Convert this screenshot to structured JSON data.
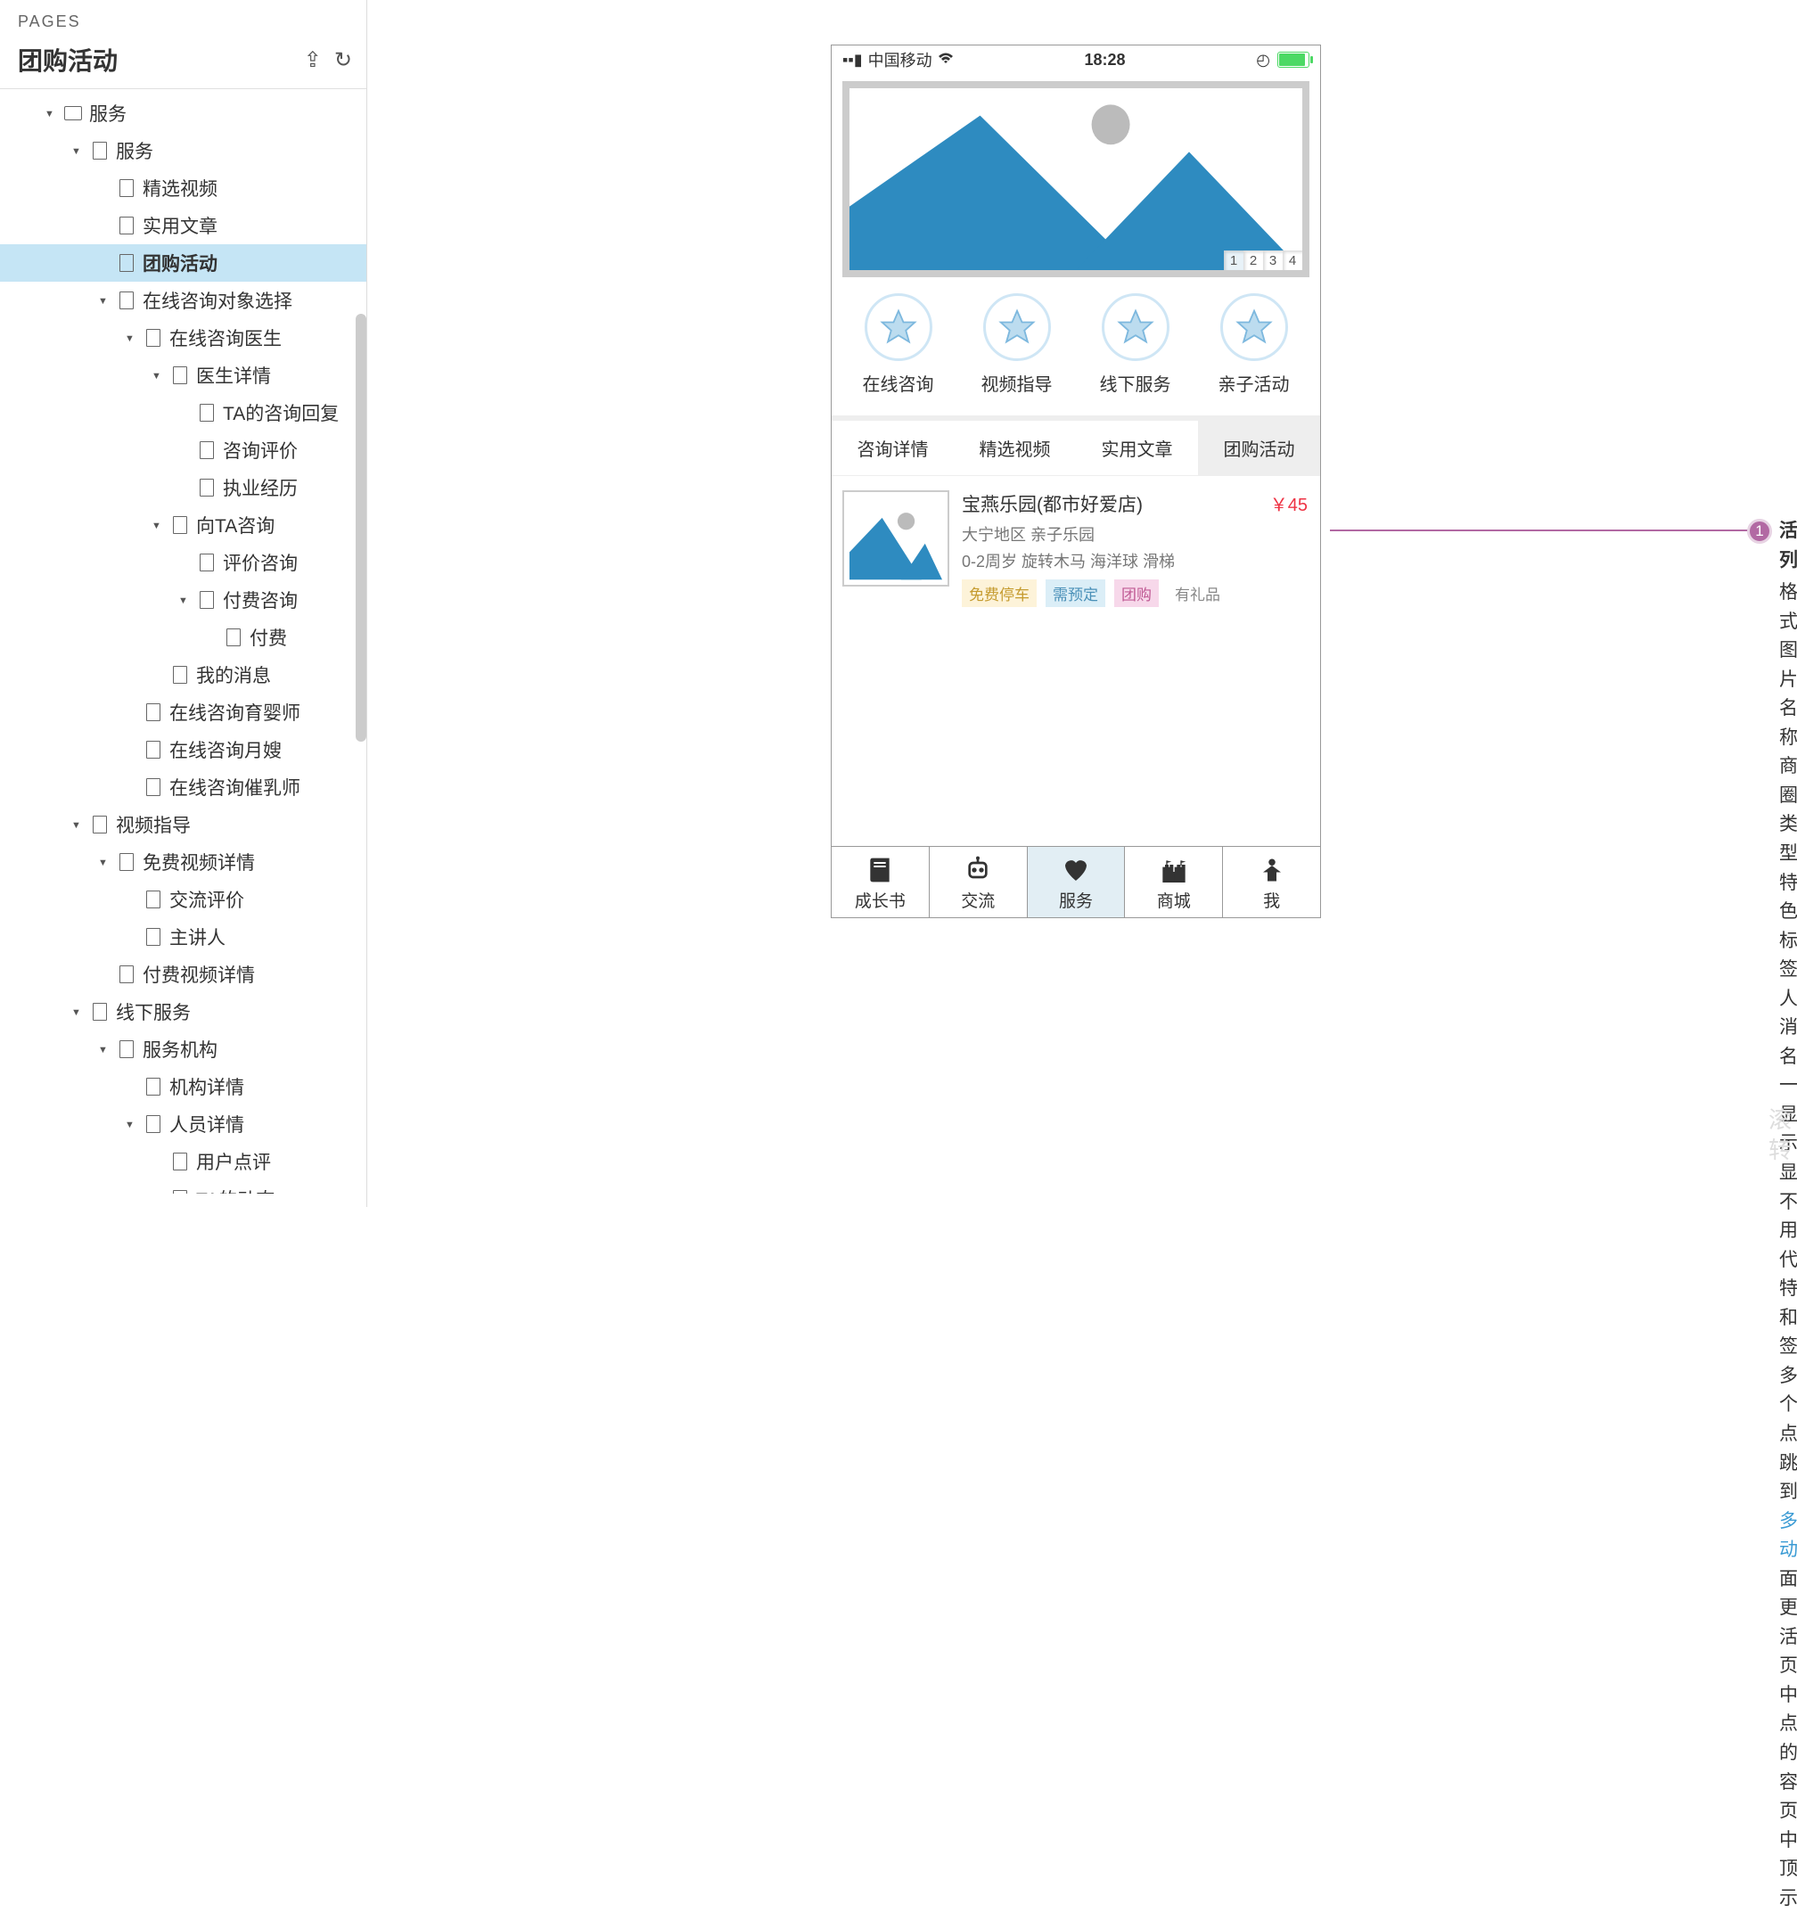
{
  "sidebar": {
    "pages_label": "PAGES",
    "current_page": "团购活动",
    "tree": [
      {
        "l": 1,
        "a": "open",
        "i": "folder",
        "t": "服务"
      },
      {
        "l": 2,
        "a": "open",
        "i": "page",
        "t": "服务"
      },
      {
        "l": 3,
        "a": "",
        "i": "page",
        "t": "精选视频"
      },
      {
        "l": 3,
        "a": "",
        "i": "page",
        "t": "实用文章"
      },
      {
        "l": 3,
        "a": "",
        "i": "page",
        "t": "团购活动",
        "active": true
      },
      {
        "l": 3,
        "a": "open",
        "i": "page",
        "t": "在线咨询对象选择"
      },
      {
        "l": 4,
        "a": "open",
        "i": "page",
        "t": "在线咨询医生"
      },
      {
        "l": 5,
        "a": "open",
        "i": "page",
        "t": "医生详情"
      },
      {
        "l": 6,
        "a": "",
        "i": "page",
        "t": "TA的咨询回复"
      },
      {
        "l": 6,
        "a": "",
        "i": "page",
        "t": "咨询评价"
      },
      {
        "l": 6,
        "a": "",
        "i": "page",
        "t": "执业经历"
      },
      {
        "l": 5,
        "a": "open",
        "i": "page",
        "t": "向TA咨询"
      },
      {
        "l": 6,
        "a": "",
        "i": "page",
        "t": "评价咨询"
      },
      {
        "l": 6,
        "a": "open",
        "i": "page",
        "t": "付费咨询"
      },
      {
        "l": 7,
        "a": "",
        "i": "page",
        "t": "付费"
      },
      {
        "l": 5,
        "a": "",
        "i": "page",
        "t": "我的消息"
      },
      {
        "l": 4,
        "a": "",
        "i": "page",
        "t": "在线咨询育婴师"
      },
      {
        "l": 4,
        "a": "",
        "i": "page",
        "t": "在线咨询月嫂"
      },
      {
        "l": 4,
        "a": "",
        "i": "page",
        "t": "在线咨询催乳师"
      },
      {
        "l": 2,
        "a": "open",
        "i": "page",
        "t": "视频指导"
      },
      {
        "l": 3,
        "a": "open",
        "i": "page",
        "t": "免费视频详情"
      },
      {
        "l": 4,
        "a": "",
        "i": "page",
        "t": "交流评价"
      },
      {
        "l": 4,
        "a": "",
        "i": "page",
        "t": "主讲人"
      },
      {
        "l": 3,
        "a": "",
        "i": "page",
        "t": "付费视频详情"
      },
      {
        "l": 2,
        "a": "open",
        "i": "page",
        "t": "线下服务"
      },
      {
        "l": 3,
        "a": "open",
        "i": "page",
        "t": "服务机构"
      },
      {
        "l": 4,
        "a": "",
        "i": "page",
        "t": "机构详情"
      },
      {
        "l": 4,
        "a": "open",
        "i": "page",
        "t": "人员详情"
      },
      {
        "l": 5,
        "a": "",
        "i": "page",
        "t": "用户点评"
      },
      {
        "l": 5,
        "a": "open",
        "i": "page",
        "t": "TA的动态"
      }
    ]
  },
  "phone": {
    "carrier": "中国移动",
    "time": "18:28",
    "pager": [
      "1",
      "2",
      "3",
      "4"
    ],
    "categories": [
      {
        "label": "在线咨询"
      },
      {
        "label": "视频指导"
      },
      {
        "label": "线下服务"
      },
      {
        "label": "亲子活动"
      }
    ],
    "tabs": [
      {
        "label": "咨询详情"
      },
      {
        "label": "精选视频"
      },
      {
        "label": "实用文章"
      },
      {
        "label": "团购活动",
        "active": true
      }
    ],
    "item": {
      "title": "宝燕乐园(都市好爱店)",
      "sub1": "大宁地区  亲子乐园",
      "sub2": "0-2周岁 旋转木马 海洋球 滑梯",
      "price": "￥45",
      "tags": [
        {
          "t": "免费停车",
          "c": "yellow"
        },
        {
          "t": "需预定",
          "c": "blue"
        },
        {
          "t": "团购",
          "c": "pink"
        },
        {
          "t": "有礼品",
          "c": "plain"
        }
      ]
    },
    "nav": [
      {
        "label": "成长书",
        "icon": "📕"
      },
      {
        "label": "交流",
        "icon": "robot"
      },
      {
        "label": "服务",
        "icon": "❤",
        "active": true
      },
      {
        "label": "商城",
        "icon": "🏰"
      },
      {
        "label": "我",
        "icon": "person"
      }
    ]
  },
  "annotation": {
    "num": "1",
    "title": "活动列表",
    "lines": [
      "格式：图片，名称，商圈，类型，特色，标签，人均消费",
      "名称一行显示，显示不全用...代替",
      "特色和标签最多四个",
      [
        "点击跳转到",
        "更多活动",
        "页面"
      ],
      "更多活动页面中，点击的内容在页面中置顶显示"
    ]
  },
  "faded": "滚\n转"
}
